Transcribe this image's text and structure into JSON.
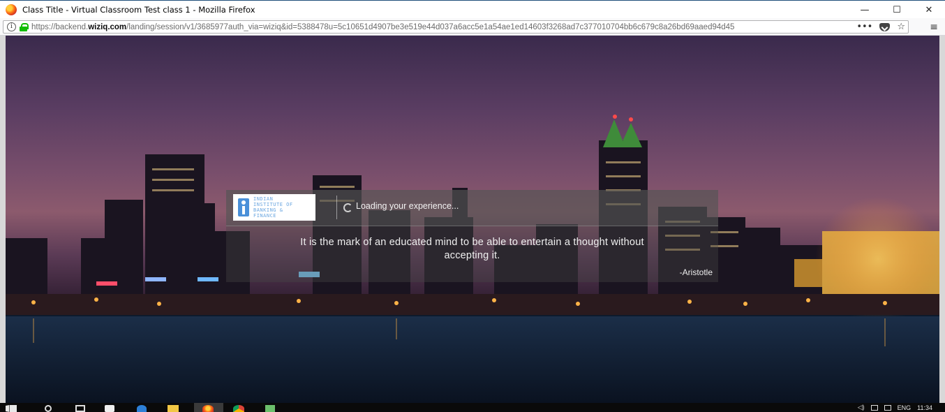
{
  "window": {
    "title": "Class Title - Virtual Classroom Test class 1 - Mozilla Firefox",
    "controls": {
      "minimize": "—",
      "maximize": "☐",
      "close": "✕"
    }
  },
  "address_bar": {
    "url_prefix": "https://backend.",
    "url_domain": "wiziq.com",
    "url_rest": "/landing/session/v1/3685977auth_via=wiziq&id=5388478u=5c10651d4907be3e519e44d037a6acc5e1a54ae1ed14603f3268ad7c377010704bb6c679c8a26bd69aaed94d45",
    "more_label": "•••",
    "bookmark_star": "☆",
    "menu_glyph": "≡"
  },
  "loader": {
    "logo_lines": [
      "INDIAN",
      "INSTITUTE OF",
      "BANKING &",
      "FINANCE"
    ],
    "loading_text": "Loading your experience...",
    "quote_line1": "It is the mark of an educated mind to be able to entertain a thought without",
    "quote_line2": "accepting it.",
    "author": "-Aristotle"
  },
  "taskbar": {
    "language": "ENG",
    "time": "11:34"
  },
  "colors": {
    "lock": "#12bc00",
    "logo_blue": "#4a90d9",
    "titlebar_border": "#1f4e79"
  }
}
